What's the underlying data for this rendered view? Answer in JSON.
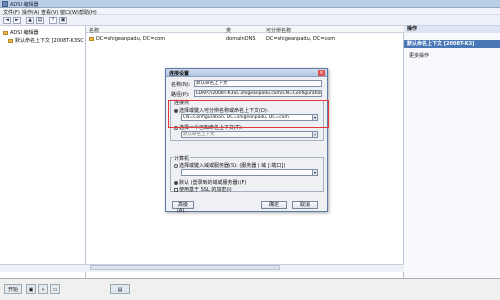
{
  "window": {
    "title": "ADSI 编辑器"
  },
  "menu": [
    "文件(F)",
    "操作(A)",
    "查看(V)",
    "窗口(W)",
    "帮助(H)"
  ],
  "toolbar_icons": [
    "back-icon",
    "forward-icon",
    "up-icon",
    "properties-icon",
    "help-icon",
    "console-icon"
  ],
  "tree": {
    "root": "ADSI 编辑器",
    "child": "默认命名上下文 [2008T-K3SC"
  },
  "list": {
    "columns": [
      "名称",
      "类",
      "可分辨名称"
    ],
    "rows": [
      {
        "name": "DC=shigeanpadu, DC=com",
        "class": "domainDNS",
        "dn": "DC=shigeanpadu, DC=com"
      }
    ]
  },
  "actions": {
    "header": "操作",
    "selected": "默认命名上下文 [2008T-K3]",
    "more": "更多操作"
  },
  "dialog": {
    "title": "连接设置",
    "name_label": "名称(N):",
    "name_value": "默认命名上下文",
    "path_label": "路径(P):",
    "path_value": "LDAP://2008T-K3SC.shigeanpadu.com/CN=Configuration",
    "connection_point_label": "连接点",
    "option1_label": "选择或键入可分辨名称或命名上下文(D):",
    "option1_value": "CN=Configuration, DC=shigeanpadu, DC=com",
    "option2_label": "选择一个已知命名上下文(T):",
    "option2_value": "默认命名上下文",
    "computer_label": "计算机",
    "computer_opt1": "选择或键入域或服务器(S): (服务器 | 域 [:端口])",
    "computer_opt2": "默认 (登录到的域或服务器)(F)",
    "ssl_label": "使用基于 SSL 的加密(I)",
    "advanced_button": "高级(A)...",
    "ok_button": "确定",
    "cancel_button": "取消"
  },
  "taskbar": {
    "start": "开始"
  }
}
